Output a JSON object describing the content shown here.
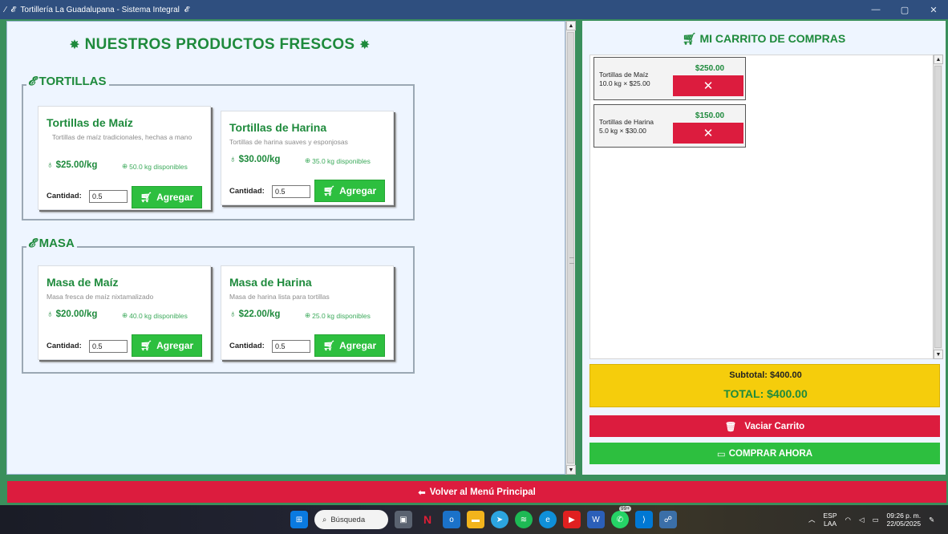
{
  "window": {
    "title": "Tortillería La Guadalupana - Sistema Integral",
    "minimize_label": "—",
    "maximize_label": "▢",
    "close_label": "✕"
  },
  "products": {
    "title": "NUESTROS PRODUCTOS FRESCOS",
    "quantity_label": "Cantidad:",
    "add_label": "Agregar",
    "groups": [
      {
        "label": "TORTILLAS",
        "items": [
          {
            "name": "Tortillas de Maíz",
            "desc": "Tortillas de maíz tradicionales, hechas a mano",
            "price": "$25.00/kg",
            "stock": "50.0 kg disponibles",
            "qty": "0.5"
          },
          {
            "name": "Tortillas de Harina",
            "desc": "Tortillas de harina suaves y esponjosas",
            "price": "$30.00/kg",
            "stock": "35.0 kg disponibles",
            "qty": "0.5"
          }
        ]
      },
      {
        "label": "MASA",
        "items": [
          {
            "name": "Masa de Maíz",
            "desc": "Masa fresca de maíz nixtamalizado",
            "price": "$20.00/kg",
            "stock": "40.0 kg disponibles",
            "qty": "0.5"
          },
          {
            "name": "Masa de Harina",
            "desc": "Masa de harina lista para tortillas",
            "price": "$22.00/kg",
            "stock": "25.0 kg disponibles",
            "qty": "0.5"
          }
        ]
      }
    ]
  },
  "cart": {
    "title": "MI CARRITO DE COMPRAS",
    "items": [
      {
        "name": "Tortillas de Maíz",
        "detail": "10.0 kg × $25.00",
        "total": "$250.00",
        "remove_label": "✕"
      },
      {
        "name": "Tortillas de Harina",
        "detail": "5.0 kg × $30.00",
        "total": "$150.00",
        "remove_label": "✕"
      }
    ],
    "subtotal": "Subtotal: $400.00",
    "total": "TOTAL: $400.00",
    "clear_label": "Vaciar Carrito",
    "buy_label": "COMPRAR AHORA"
  },
  "back_label": "Volver al Menú Principal",
  "taskbar": {
    "search_placeholder": "Búsqueda",
    "whatsapp_badge": "99+",
    "lang_1": "ESP",
    "lang_2": "LAA",
    "time": "09:26 p. m.",
    "date": "22/05/2025"
  },
  "colors": {
    "brand_green": "#1e8a3c",
    "button_green": "#2dbf3f",
    "button_red": "#dc1c3e",
    "totals_yellow": "#f5cd0c",
    "frame_green": "#3a8f5c",
    "titlebar_blue": "#2f4f7f"
  }
}
